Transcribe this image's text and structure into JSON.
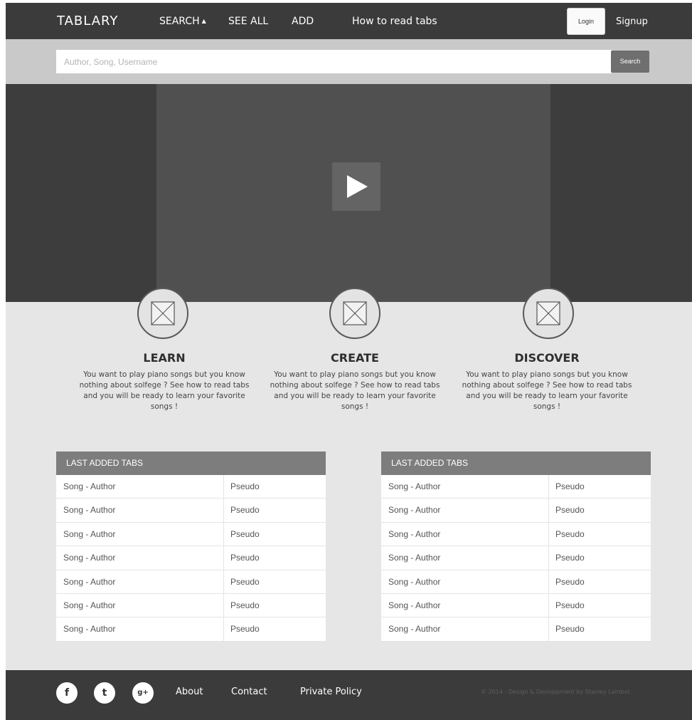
{
  "nav": {
    "brand": "TABLARY",
    "search": "SEARCH",
    "search_caret": "▲",
    "see_all": "SEE ALL",
    "add": "ADD",
    "how_to": "How to read tabs",
    "login": "Login",
    "signup": "Signup"
  },
  "search": {
    "placeholder": "Author, Song, Username",
    "button": "Search"
  },
  "features": [
    {
      "title": "LEARN",
      "desc": "You want to play piano songs but you know nothing about solfege ? See how to read tabs and you will be ready to learn your favorite songs !",
      "icon": "image-placeholder-icon"
    },
    {
      "title": "CREATE",
      "desc": "You want to play piano songs but you know nothing about solfege ? See how to read tabs and you will be ready to learn your favorite songs !",
      "icon": "image-placeholder-icon"
    },
    {
      "title": "DISCOVER",
      "desc": "You want to play piano songs but you know nothing about solfege ? See how to read tabs and you will be ready to learn your favorite songs !",
      "icon": "image-placeholder-icon"
    }
  ],
  "tables": [
    {
      "header": "LAST ADDED TABS",
      "rows": [
        {
          "song": "Song - Author",
          "user": "Pseudo"
        },
        {
          "song": "Song - Author",
          "user": "Pseudo"
        },
        {
          "song": "Song - Author",
          "user": "Pseudo"
        },
        {
          "song": "Song - Author",
          "user": "Pseudo"
        },
        {
          "song": "Song - Author",
          "user": "Pseudo"
        },
        {
          "song": "Song - Author",
          "user": "Pseudo"
        },
        {
          "song": "Song - Author",
          "user": "Pseudo"
        }
      ]
    },
    {
      "header": "LAST ADDED TABS",
      "rows": [
        {
          "song": "Song - Author",
          "user": "Pseudo"
        },
        {
          "song": "Song - Author",
          "user": "Pseudo"
        },
        {
          "song": "Song - Author",
          "user": "Pseudo"
        },
        {
          "song": "Song - Author",
          "user": "Pseudo"
        },
        {
          "song": "Song - Author",
          "user": "Pseudo"
        },
        {
          "song": "Song - Author",
          "user": "Pseudo"
        },
        {
          "song": "Song - Author",
          "user": "Pseudo"
        }
      ]
    }
  ],
  "footer": {
    "social": [
      "f",
      "t",
      "g+"
    ],
    "links": [
      "About",
      "Contact",
      "Private Policy"
    ],
    "copyright": "© 2014 - Design & Devloppment by Stanley Lambot"
  },
  "colors": {
    "nav_bg": "#3b3b3b",
    "search_bg": "#c9c9c9",
    "hero_bg": "#3d3d3d",
    "video_bg": "#505050",
    "content_bg": "#e6e6e6",
    "table_header": "#7d7d7d"
  }
}
